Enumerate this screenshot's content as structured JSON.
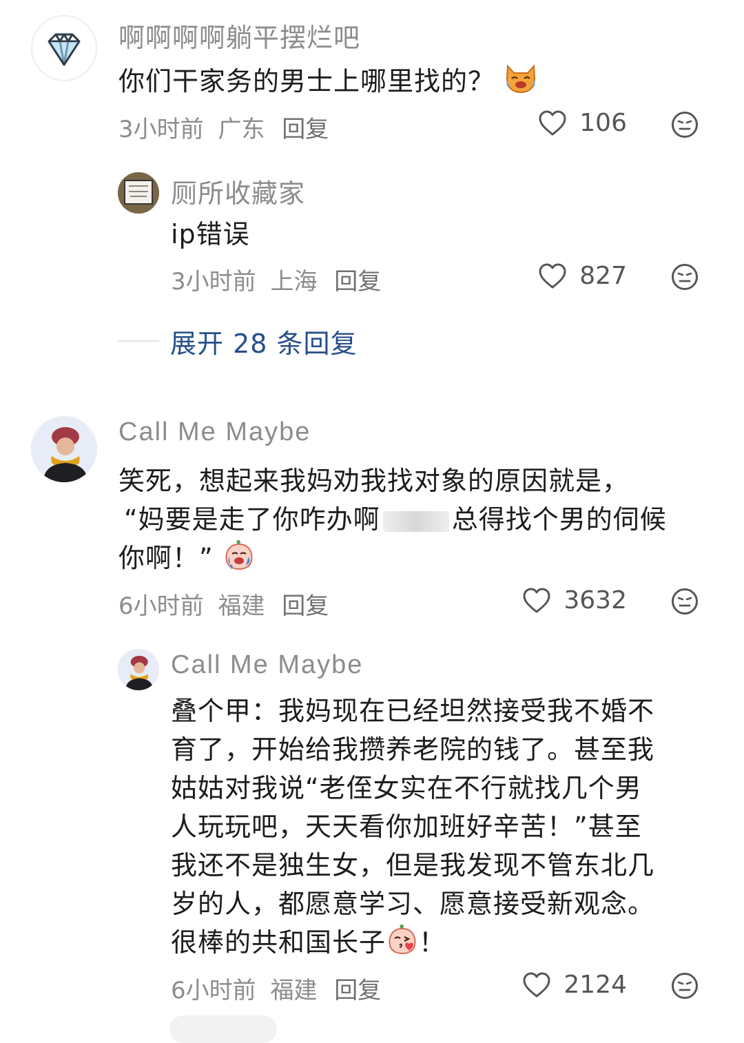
{
  "comments": [
    {
      "username": "啊啊啊啊躺平摆烂吧",
      "text": "你们干家务的男士上哪里找的？",
      "time": "3小时前",
      "location": "广东",
      "reply_label": "回复",
      "likes": "106",
      "emoji": "cat-crying-laughing-emoji",
      "replies": [
        {
          "username": "厕所收藏家",
          "text": "ip错误",
          "time": "3小时前",
          "location": "上海",
          "reply_label": "回复",
          "likes": "827"
        }
      ],
      "expand_label": "展开 28 条回复"
    },
    {
      "username": "Call Me Maybe",
      "text_line1": "笑死，想起来我妈劝我找对象的原因就是，",
      "text_line2a": "“妈要是走了你咋办啊",
      "text_line2b": "总得找个男的伺候",
      "text_line3": "你啊！”",
      "time": "6小时前",
      "location": "福建",
      "reply_label": "回复",
      "likes": "3632",
      "emoji": "peach-crying-emoji",
      "replies": [
        {
          "username": "Call Me Maybe",
          "lines": [
            "叠个甲：我妈现在已经坦然接受我不婚不",
            "育了，开始给我攒养老院的钱了。甚至我",
            "姑姑对我说“老侄女实在不行就找几个男",
            "人玩玩吧，天天看你加班好辛苦！”甚至",
            "我还不是独生女，但是我发现不管东北几",
            "岁的人，都愿意学习、愿意接受新观念。"
          ],
          "last_line": "很棒的共和国长子",
          "last_suffix": "！",
          "time": "6小时前",
          "location": "福建",
          "reply_label": "回复",
          "likes": "2124",
          "emoji": "peach-kiss-emoji"
        }
      ]
    }
  ],
  "colors": {
    "username": "#8c8c8c",
    "expand_link": "#264f8a",
    "text": "#1c1c1c"
  }
}
